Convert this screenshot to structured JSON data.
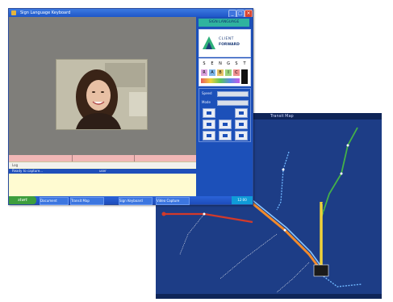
{
  "window": {
    "title": "Sign Language Keyboard",
    "minimize": "_",
    "maximize": "□",
    "close": "×"
  },
  "sidebar": {
    "banner": "SIGN LANGUAGE",
    "logo_line1": "CLIENT",
    "logo_line2": "FORWARD",
    "symbols": [
      "S",
      "E",
      "N",
      "G",
      "S",
      "T",
      "R",
      "A",
      "B",
      "I",
      "C"
    ],
    "controls": {
      "label_1": "Speed",
      "label_2": "Mode"
    }
  },
  "log": {
    "header": "Log",
    "row_left": "Ready to capture...",
    "row_right": "user"
  },
  "taskbar": {
    "start": "start",
    "tasks": [
      "Document",
      "Transit Map",
      "Sign Keyboard",
      "Video Capture"
    ],
    "clock": "12:00"
  },
  "map": {
    "header": "Transit Map",
    "line_colors": {
      "red": "#d23a2a",
      "yellow": "#f0d23a",
      "green": "#44b048",
      "orange": "#f28a2a",
      "blue": "#6fb7ff"
    }
  },
  "colors": {
    "window_bg": "#7d7c79",
    "sidebar_bg": "#1c50b9",
    "banner_teal": "#2fb39f",
    "map_bg": "#1d3d86"
  }
}
